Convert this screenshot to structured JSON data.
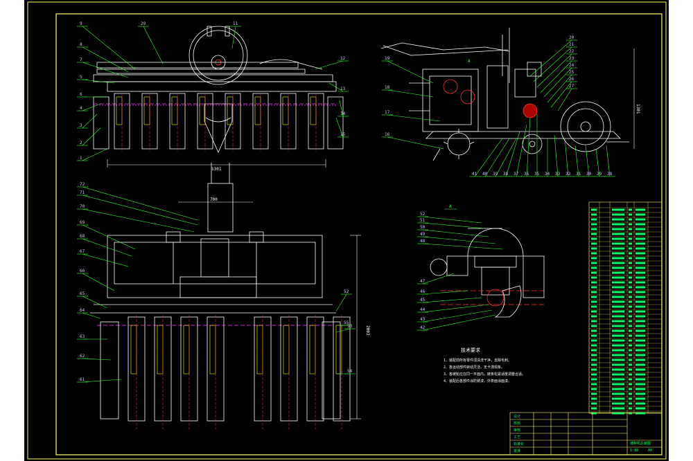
{
  "drawing": {
    "colors": {
      "background": "#000000",
      "frame": "#ffff66",
      "geometry": "#ffffff",
      "leaders": "#33ff33",
      "hidden": "#ff33ff",
      "centerline": "#ff3333",
      "accent_yellow": "#ffff00",
      "table_text": "#00ff66"
    },
    "front_view": {
      "balloons": [
        "9",
        "29",
        "11",
        "8",
        "7",
        "5",
        "6",
        "4",
        "3",
        "2",
        "1",
        "12",
        "13",
        "14",
        "15"
      ],
      "dimension": "1301"
    },
    "side_view": {
      "balloons": [
        "19",
        "18",
        "17",
        "16",
        "20",
        "21",
        "22",
        "23",
        "24",
        "25",
        "26",
        "27",
        "41",
        "40",
        "39",
        "38",
        "37",
        "36",
        "35",
        "34",
        "33",
        "32",
        "31",
        "30",
        "29",
        "28"
      ],
      "dimension": "1301",
      "section_mark": "A"
    },
    "plan_view": {
      "balloons": [
        "72",
        "71",
        "70",
        "69",
        "68",
        "67",
        "66",
        "65",
        "64",
        "63",
        "62",
        "61",
        "52",
        "53",
        "54",
        "55"
      ],
      "top_dimension": "700",
      "side_dimension": "2003"
    },
    "detail_view": {
      "title": "A",
      "balloons": [
        "52",
        "51",
        "50",
        "49",
        "48",
        "47",
        "46",
        "45",
        "44",
        "43",
        "42"
      ]
    },
    "notes": {
      "heading": "技术要求",
      "items": [
        "1、装配前所有零件须清洗干净，去除毛刺。",
        "2、各运动部件转动灵活，无卡滞现象。",
        "3、各链轮应在同一平面内，链条松紧适度调整合适。",
        "4、装配后各部件涂防锈漆，外表面涂面漆。"
      ]
    },
    "title_block": {
      "rows": [
        "设计",
        "校核",
        "审核",
        "工艺",
        "标准化",
        "批准"
      ],
      "drawing_name": "播种机总装图",
      "scale": "1:10",
      "sheet": "A0"
    }
  }
}
